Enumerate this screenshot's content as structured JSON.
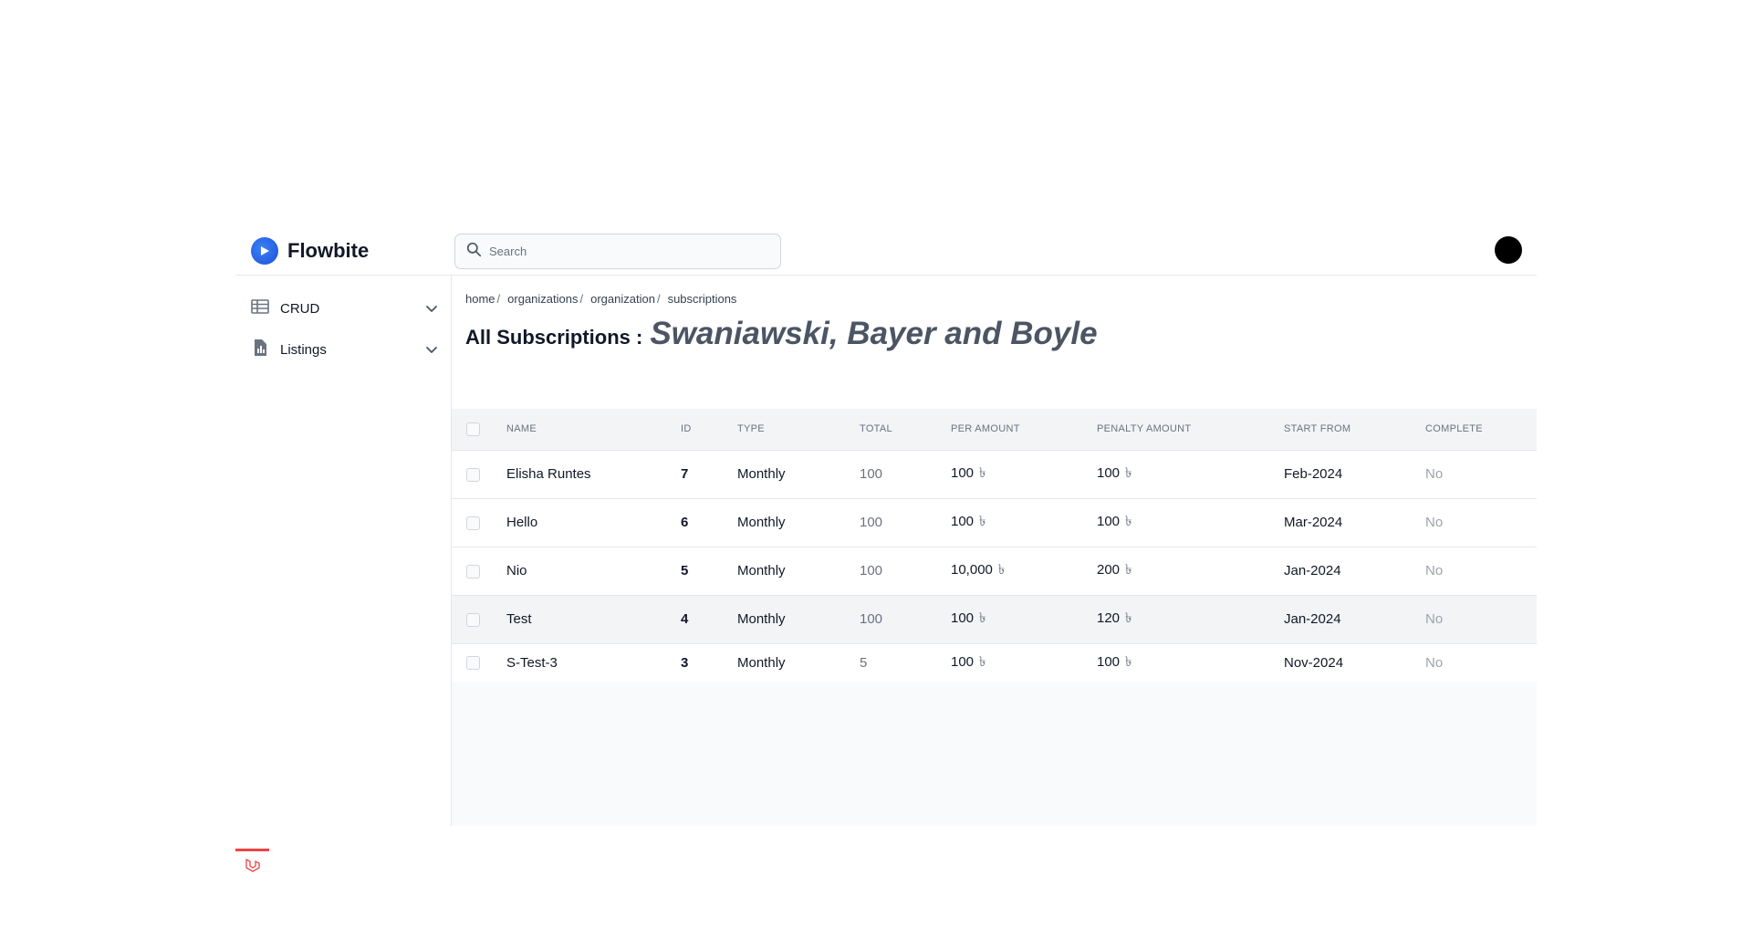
{
  "app": {
    "brand": "Flowbite",
    "brand_color": "#1d4ed8"
  },
  "search": {
    "placeholder": "Search",
    "value": ""
  },
  "sidebar": {
    "items": [
      {
        "label": "CRUD",
        "icon": "table-icon"
      },
      {
        "label": "Listings",
        "icon": "document-chart-icon"
      }
    ]
  },
  "breadcrumb": {
    "items": [
      "home",
      "organizations",
      "organization",
      "subscriptions"
    ],
    "separator": "/"
  },
  "page": {
    "title": "All Subscriptions :",
    "organization": "Swaniawski, Bayer and Boyle"
  },
  "table": {
    "headers": [
      "NAME",
      "ID",
      "TYPE",
      "TOTAL",
      "PER AMOUNT",
      "PENALTY AMOUNT",
      "START FROM",
      "COMPLETE"
    ],
    "currency_symbol": "৳",
    "rows": [
      {
        "name": "Elisha Runtes",
        "id": "7",
        "type": "Monthly",
        "total": "100",
        "per_amount": "100",
        "penalty_amount": "100",
        "start_from": "Feb-2024",
        "complete": "No"
      },
      {
        "name": "Hello",
        "id": "6",
        "type": "Monthly",
        "total": "100",
        "per_amount": "100",
        "penalty_amount": "100",
        "start_from": "Mar-2024",
        "complete": "No"
      },
      {
        "name": "Nio",
        "id": "5",
        "type": "Monthly",
        "total": "100",
        "per_amount": "10,000",
        "penalty_amount": "200",
        "start_from": "Jan-2024",
        "complete": "No"
      },
      {
        "name": "Test",
        "id": "4",
        "type": "Monthly",
        "total": "100",
        "per_amount": "100",
        "penalty_amount": "120",
        "start_from": "Jan-2024",
        "complete": "No"
      },
      {
        "name": "S-Test-3",
        "id": "3",
        "type": "Monthly",
        "total": "5",
        "per_amount": "100",
        "penalty_amount": "100",
        "start_from": "Nov-2024",
        "complete": "No"
      }
    ]
  },
  "colors": {
    "accent": "#3b82f6",
    "laravel": "#ef4444"
  }
}
